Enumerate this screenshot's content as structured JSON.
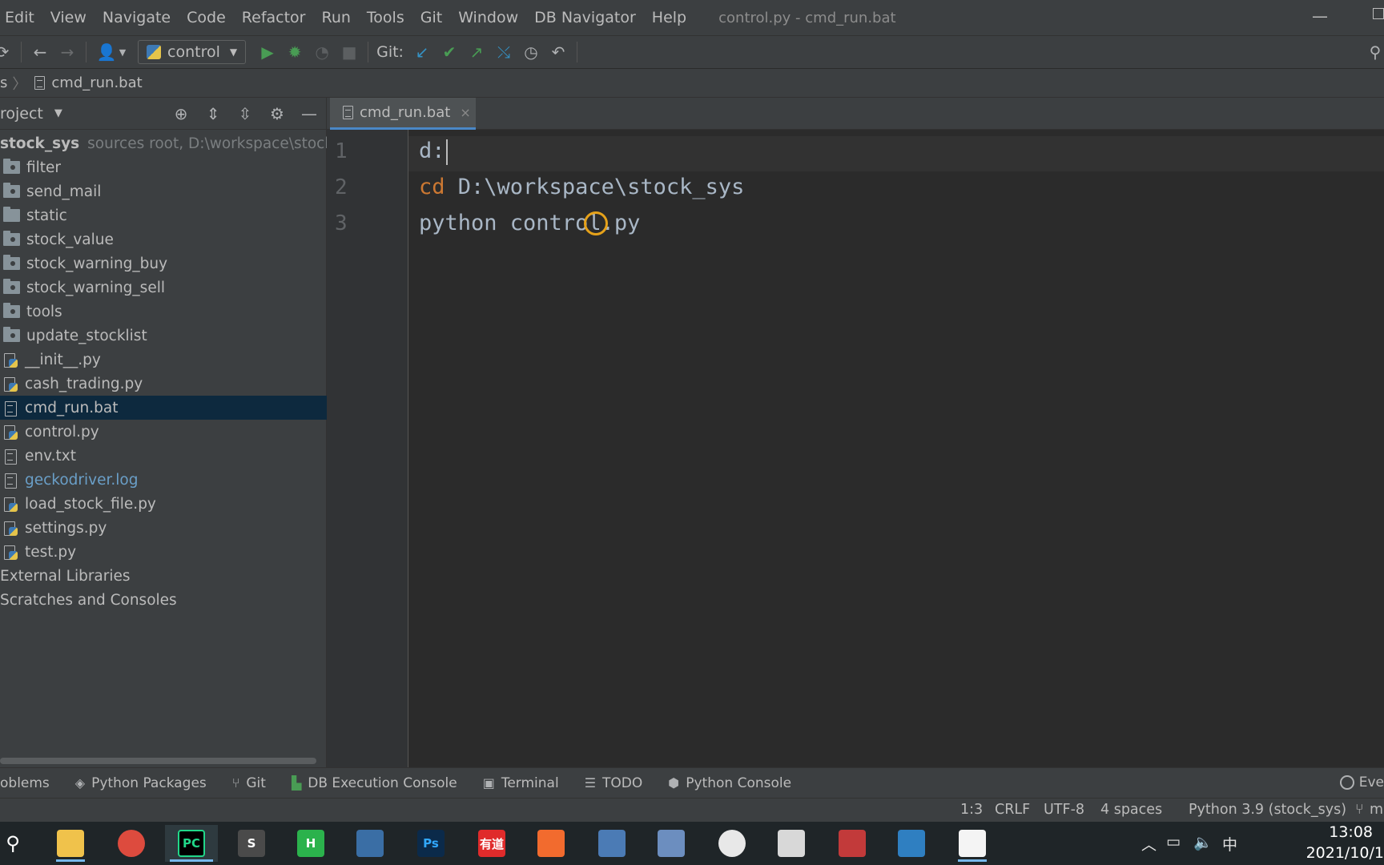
{
  "menu": {
    "items": [
      "Edit",
      "View",
      "Navigate",
      "Code",
      "Refactor",
      "Run",
      "Tools",
      "Git",
      "Window",
      "DB Navigator",
      "Help"
    ],
    "window_title": "control.py - cmd_run.bat"
  },
  "toolbar": {
    "run_config": "control",
    "git_label": "Git:"
  },
  "breadcrumb": {
    "prefix": "s",
    "file": "cmd_run.bat"
  },
  "project": {
    "header": "roject",
    "root": {
      "name": "stock_sys",
      "meta": "sources root,  D:\\workspace\\stock_sy"
    },
    "items": [
      {
        "name": "filter",
        "type": "folder"
      },
      {
        "name": "send_mail",
        "type": "folder"
      },
      {
        "name": "static",
        "type": "folder"
      },
      {
        "name": "stock_value",
        "type": "folder"
      },
      {
        "name": "stock_warning_buy",
        "type": "folder"
      },
      {
        "name": "stock_warning_sell",
        "type": "folder"
      },
      {
        "name": "tools",
        "type": "folder"
      },
      {
        "name": "update_stocklist",
        "type": "folder"
      },
      {
        "name": "__init__.py",
        "type": "py"
      },
      {
        "name": "cash_trading.py",
        "type": "py"
      },
      {
        "name": "cmd_run.bat",
        "type": "txt",
        "selected": true
      },
      {
        "name": "control.py",
        "type": "py"
      },
      {
        "name": "env.txt",
        "type": "txt"
      },
      {
        "name": "geckodriver.log",
        "type": "log"
      },
      {
        "name": "load_stock_file.py",
        "type": "py"
      },
      {
        "name": "settings.py",
        "type": "py"
      },
      {
        "name": "test.py",
        "type": "py"
      }
    ],
    "external_libraries": "External Libraries",
    "scratches": "Scratches and Consoles"
  },
  "editor": {
    "tab_label": "cmd_run.bat",
    "tab_close": "×",
    "lines": [
      {
        "number": "1",
        "keyword": "",
        "text": "d:"
      },
      {
        "number": "2",
        "keyword": "cd",
        "text": " D:\\workspace\\stock_sys"
      },
      {
        "number": "3",
        "keyword": "",
        "text": "python control.py"
      }
    ]
  },
  "tool_windows": {
    "problems": "oblems",
    "python_packages": "Python Packages",
    "git": "Git",
    "db_console": "DB Execution Console",
    "terminal": "Terminal",
    "todo": "TODO",
    "python_console": "Python Console",
    "event_log": "Eve"
  },
  "status": {
    "position": "1:3",
    "line_sep": "CRLF",
    "encoding": "UTF-8",
    "indent": "4 spaces",
    "interpreter": "Python 3.9 (stock_sys)",
    "branch": "m"
  },
  "taskbar": {
    "clock_time": "13:08",
    "clock_date": "2021/10/1",
    "ime": "中",
    "apps": [
      {
        "name": "search",
        "label": ""
      },
      {
        "name": "file-explorer",
        "label": ""
      },
      {
        "name": "chrome",
        "label": ""
      },
      {
        "name": "pycharm",
        "label": "PC"
      },
      {
        "name": "sublime",
        "label": "S"
      },
      {
        "name": "hbuilder",
        "label": "H"
      },
      {
        "name": "remote-desktop",
        "label": ""
      },
      {
        "name": "photoshop",
        "label": "Ps"
      },
      {
        "name": "youdao",
        "label": "有道"
      },
      {
        "name": "sketch",
        "label": ""
      },
      {
        "name": "calculator",
        "label": ""
      },
      {
        "name": "paint",
        "label": ""
      },
      {
        "name": "clock",
        "label": ""
      },
      {
        "name": "jar",
        "label": ""
      },
      {
        "name": "solitaire",
        "label": ""
      },
      {
        "name": "copy-tool",
        "label": ""
      },
      {
        "name": "notepad",
        "label": ""
      }
    ]
  },
  "colors": {
    "accent": "#4a88c7",
    "keyword": "#cc7832",
    "selection": "#0d293e",
    "click_indicator": "#e6a21a"
  }
}
